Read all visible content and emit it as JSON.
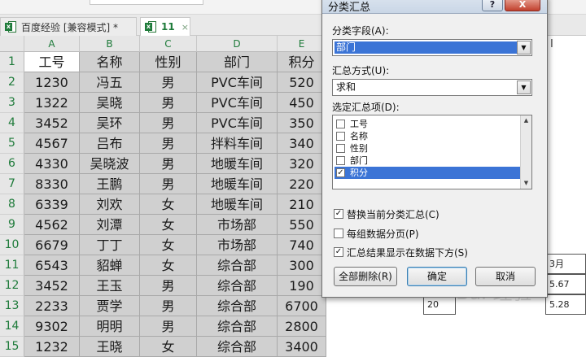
{
  "tabs": [
    {
      "label": "百度经验  [兼容模式] *"
    },
    {
      "label": "11",
      "close": "×"
    }
  ],
  "columns": [
    "A",
    "B",
    "C",
    "D",
    "E"
  ],
  "rows": [
    "1",
    "2",
    "3",
    "4",
    "5",
    "6",
    "7",
    "8",
    "9",
    "10",
    "11",
    "12",
    "13",
    "14",
    "15"
  ],
  "table": {
    "header": [
      "工号",
      "名称",
      "性别",
      "部门",
      "积分"
    ],
    "data": [
      [
        "1230",
        "冯五",
        "男",
        "PVC车间",
        "520"
      ],
      [
        "1322",
        "吴晓",
        "男",
        "PVC车间",
        "450"
      ],
      [
        "3452",
        "吴环",
        "男",
        "PVC车间",
        "350"
      ],
      [
        "4567",
        "吕布",
        "男",
        "拌料车间",
        "340"
      ],
      [
        "4330",
        "吴晓波",
        "男",
        "地暖车间",
        "320"
      ],
      [
        "8330",
        "王鹏",
        "男",
        "地暖车间",
        "220"
      ],
      [
        "6339",
        "刘欢",
        "女",
        "地暖车间",
        "210"
      ],
      [
        "4562",
        "刘潭",
        "女",
        "市场部",
        "550"
      ],
      [
        "6679",
        "丁丁",
        "女",
        "市场部",
        "740"
      ],
      [
        "6543",
        "貂蝉",
        "女",
        "综合部",
        "300"
      ],
      [
        "3452",
        "王玉",
        "男",
        "综合部",
        "190"
      ],
      [
        "2233",
        "贾学",
        "男",
        "综合部",
        "6700"
      ],
      [
        "9302",
        "明明",
        "男",
        "综合部",
        "2800"
      ],
      [
        "1232",
        "王晓",
        "女",
        "综合部",
        "3400"
      ]
    ]
  },
  "right_panel": [
    {
      "text": "3月"
    },
    {
      "text": "5.67"
    },
    {
      "text": "20"
    },
    {
      "text": "5.28"
    }
  ],
  "cursor_glyph": "I",
  "dialog": {
    "title": "分类汇总",
    "help": "?",
    "close": "X",
    "field_label": "分类字段(A):",
    "field_value": "部门",
    "method_label": "汇总方式(U):",
    "method_value": "求和",
    "items_label": "选定汇总项(D):",
    "items": [
      {
        "label": "工号",
        "checked": false,
        "check_glyph": ""
      },
      {
        "label": "名称",
        "checked": false,
        "check_glyph": ""
      },
      {
        "label": "性别",
        "checked": false,
        "check_glyph": ""
      },
      {
        "label": "部门",
        "checked": false,
        "check_glyph": ""
      },
      {
        "label": "积分",
        "checked": true,
        "check_glyph": "✓"
      }
    ],
    "options": [
      {
        "label": "替换当前分类汇总(C)",
        "checked": true,
        "check_glyph": "✓"
      },
      {
        "label": "每组数据分页(P)",
        "checked": false,
        "check_glyph": ""
      },
      {
        "label": "汇总结果显示在数据下方(S)",
        "checked": true,
        "check_glyph": "✓"
      }
    ],
    "buttons": {
      "remove_all": "全部删除(R)",
      "ok": "确定",
      "cancel": "取消"
    }
  },
  "watermark": "Bai 经验",
  "colors": {
    "selection": "#3b74d6",
    "cell_fill": "#d0d0d0",
    "header_green": "#1e7b3a"
  }
}
